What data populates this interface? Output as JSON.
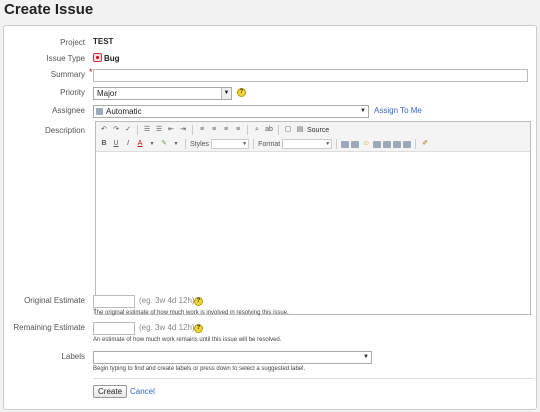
{
  "page": {
    "title": "Create Issue"
  },
  "form": {
    "project": {
      "label": "Project",
      "value": "TEST"
    },
    "issue_type": {
      "label": "Issue Type",
      "value": "Bug",
      "icon": "bug-icon"
    },
    "summary": {
      "label": "Summary",
      "required_mark": "*",
      "value": ""
    },
    "priority": {
      "label": "Priority",
      "value": "Major",
      "help": "?"
    },
    "assignee": {
      "label": "Assignee",
      "value": "Automatic",
      "assign_to_me": "Assign To Me"
    },
    "description": {
      "label": "Description",
      "toolbar": {
        "source": "Source",
        "styles": "Styles",
        "format": "Format"
      },
      "value": ""
    },
    "original_estimate": {
      "label": "Original Estimate",
      "example": "(eg. 3w 4d 12h)",
      "help": "?",
      "hint": "The original estimate of how much work is involved in resolving this issue."
    },
    "remaining_estimate": {
      "label": "Remaining Estimate",
      "example": "(eg. 3w 4d 12h)",
      "help": "?",
      "hint": "An estimate of how much work remains until this issue will be resolved."
    },
    "labels": {
      "label": "Labels",
      "hint": "Begin typing to find and create labels or press down to select a suggested label."
    }
  },
  "actions": {
    "create": "Create",
    "cancel": "Cancel"
  }
}
